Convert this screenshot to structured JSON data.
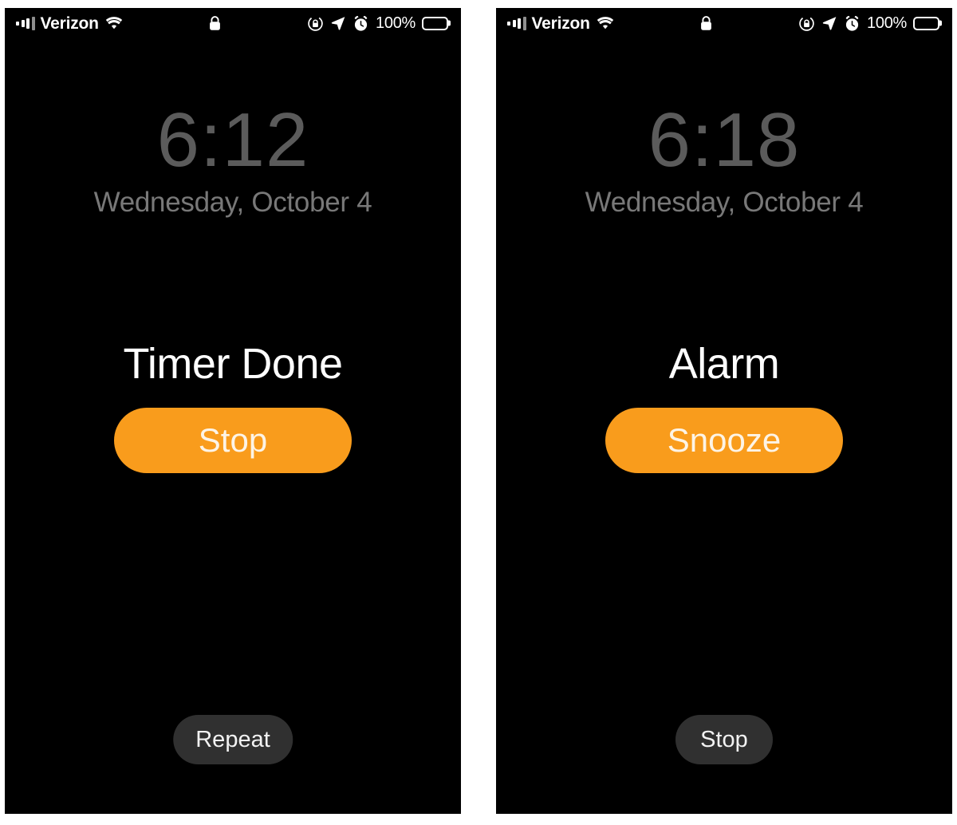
{
  "colors": {
    "screen_background": "#000000",
    "page_background": "#ffffff",
    "accent_orange": "#f99c1c",
    "secondary_button": "#303030",
    "clock_gray": "#5b5b5b",
    "date_gray": "#787878",
    "primary_text": "#ffffff"
  },
  "panels": [
    {
      "id": "timer-panel",
      "status_bar": {
        "signal_icon": "cellular-signal-icon",
        "carrier": "Verizon",
        "wifi_icon": "wifi-icon",
        "lock_icon": "lock-icon",
        "rotation_lock_icon": "rotation-lock-icon",
        "location_icon": "location-arrow-icon",
        "alarm_icon": "alarm-clock-icon",
        "battery_percent": "100%",
        "battery_icon": "battery-full-icon"
      },
      "lockscreen": {
        "time": "6:12",
        "date": "Wednesday, October 4"
      },
      "alert": {
        "title": "Timer Done",
        "primary_button": "Stop",
        "secondary_button": "Repeat"
      }
    },
    {
      "id": "alarm-panel",
      "status_bar": {
        "signal_icon": "cellular-signal-icon",
        "carrier": "Verizon",
        "wifi_icon": "wifi-icon",
        "lock_icon": "lock-icon",
        "rotation_lock_icon": "rotation-lock-icon",
        "location_icon": "location-arrow-icon",
        "alarm_icon": "alarm-clock-icon",
        "battery_percent": "100%",
        "battery_icon": "battery-full-icon"
      },
      "lockscreen": {
        "time": "6:18",
        "date": "Wednesday, October 4"
      },
      "alert": {
        "title": "Alarm",
        "primary_button": "Snooze",
        "secondary_button": "Stop"
      }
    }
  ]
}
